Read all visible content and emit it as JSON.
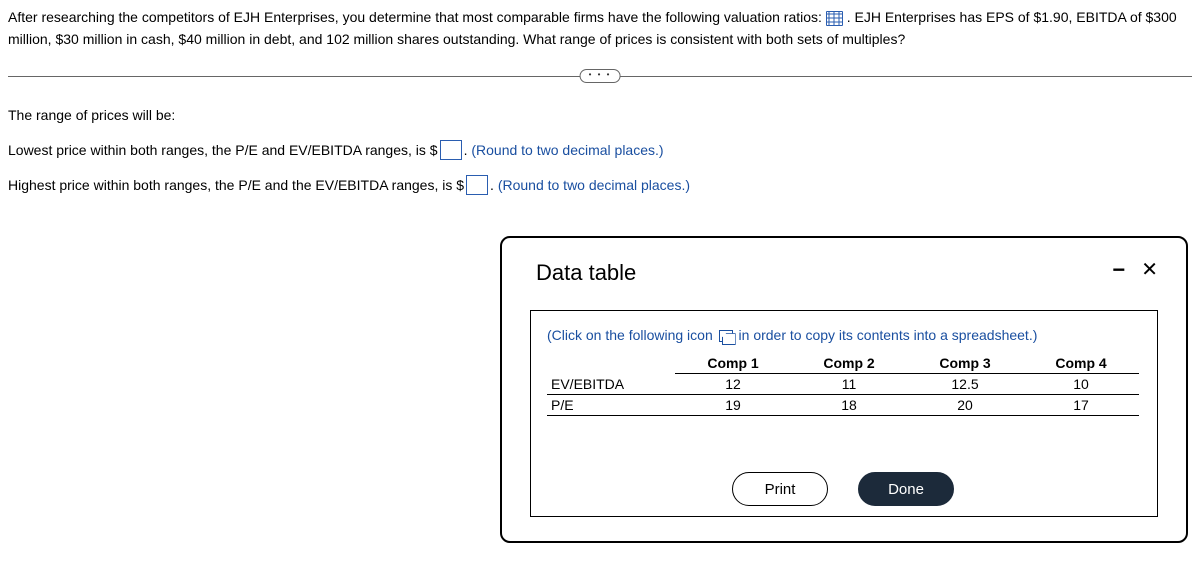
{
  "intro": {
    "part1": "After researching the competitors of EJH Enterprises, you determine that most comparable firms have the following valuation ratios:",
    "part2": ". EJH Enterprises has EPS of $1.90, EBITDA of $300 million, $30 million in cash, $40 million in debt, and 102 million shares outstanding. What range of prices is consistent with both sets of multiples?"
  },
  "toggle": "• • •",
  "heading": "The range of prices will be:",
  "q1": {
    "label_pre": "Lowest price within both ranges, the P/E and  EV/EBITDA ranges, is $",
    "label_post": ".",
    "hint": "(Round to two decimal places.)",
    "value": ""
  },
  "q2": {
    "label_pre": "Highest price within both ranges, the P/E and the EV/EBITDA ranges, is $",
    "label_post": ".",
    "hint": "(Round to two decimal places.)",
    "value": ""
  },
  "modal": {
    "title": "Data table",
    "minimize": "−",
    "close": "✕",
    "copy_hint_pre": "(Click on the following icon",
    "copy_hint_post": "in order to copy its contents into a spreadsheet.)",
    "buttons": {
      "print": "Print",
      "done": "Done"
    }
  },
  "chart_data": {
    "type": "table",
    "columns": [
      "",
      "Comp 1",
      "Comp 2",
      "Comp 3",
      "Comp 4"
    ],
    "rows": [
      {
        "label": "EV/EBITDA",
        "values": [
          12,
          11,
          12.5,
          10
        ]
      },
      {
        "label": "P/E",
        "values": [
          19,
          18,
          20,
          17
        ]
      }
    ]
  }
}
